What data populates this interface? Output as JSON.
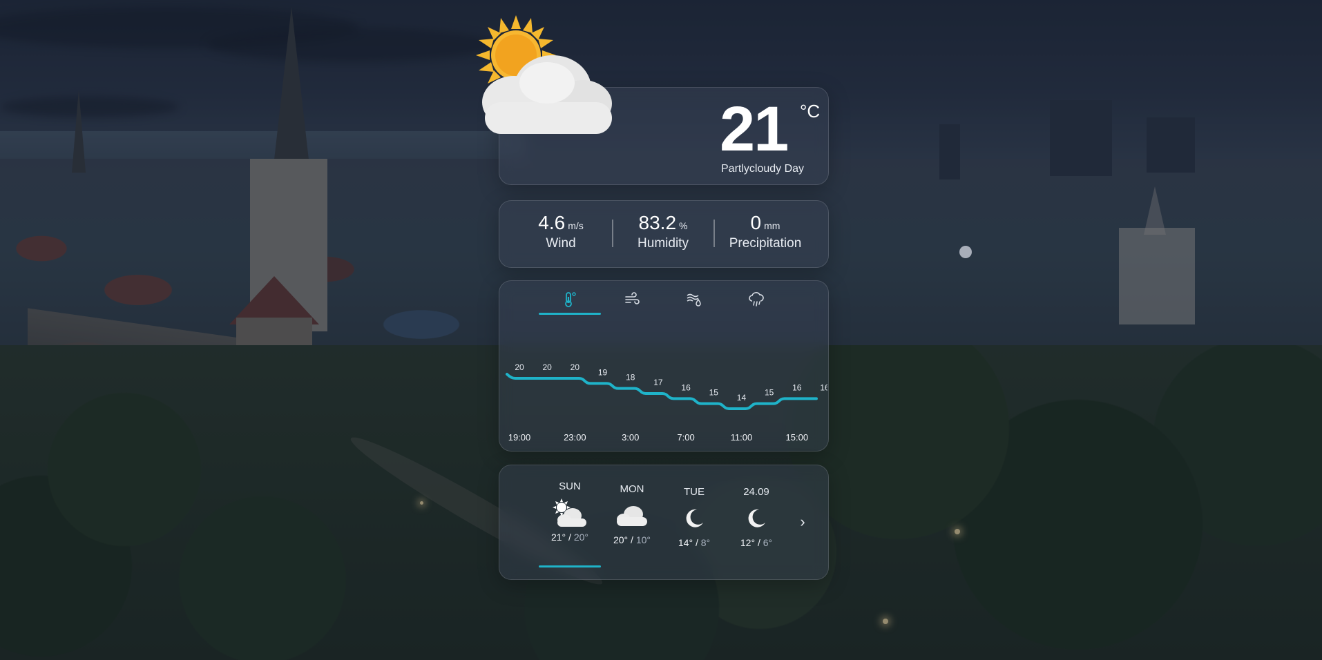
{
  "current": {
    "temperature": "21",
    "unit": "°C",
    "condition": "Partlycloudy Day",
    "icon": "partly-cloudy-day-icon"
  },
  "stats": [
    {
      "value": "4.6",
      "unit": "m/s",
      "label": "Wind"
    },
    {
      "value": "83.2",
      "unit": "%",
      "label": "Humidity"
    },
    {
      "value": "0",
      "unit": "mm",
      "label": "Precipitation"
    }
  ],
  "chart_tabs": [
    {
      "icon": "thermometer-icon",
      "active": true
    },
    {
      "icon": "wind-icon",
      "active": false
    },
    {
      "icon": "humidity-icon",
      "active": false
    },
    {
      "icon": "rain-icon",
      "active": false
    }
  ],
  "chart_data": {
    "type": "line",
    "x": [
      "19:00",
      "21:00",
      "23:00",
      "1:00",
      "3:00",
      "5:00",
      "7:00",
      "9:00",
      "11:00",
      "13:00",
      "15:00",
      "17:00"
    ],
    "values": [
      20,
      20,
      20,
      19,
      18,
      17,
      16,
      15,
      14,
      15,
      16,
      16
    ],
    "tick_labels": [
      "19:00",
      "23:00",
      "3:00",
      "7:00",
      "11:00",
      "15:00"
    ],
    "color": "#1fb3c9",
    "xlabel": "",
    "ylabel": ""
  },
  "days": [
    {
      "name": "SUN",
      "icon": "partly-cloudy-day-icon",
      "high": "21°",
      "low": "20°",
      "active": true
    },
    {
      "name": "MON",
      "icon": "cloud-icon",
      "high": "20°",
      "low": "10°",
      "active": false
    },
    {
      "name": "TUE",
      "icon": "moon-icon",
      "high": "14°",
      "low": "8°",
      "active": false
    },
    {
      "name": "24.09",
      "icon": "moon-icon",
      "high": "12°",
      "low": "6°",
      "active": false
    }
  ],
  "separator": "/",
  "colors": {
    "accent": "#1fb3c9",
    "sun": "#f7b731",
    "cloud": "#eeeeee"
  }
}
